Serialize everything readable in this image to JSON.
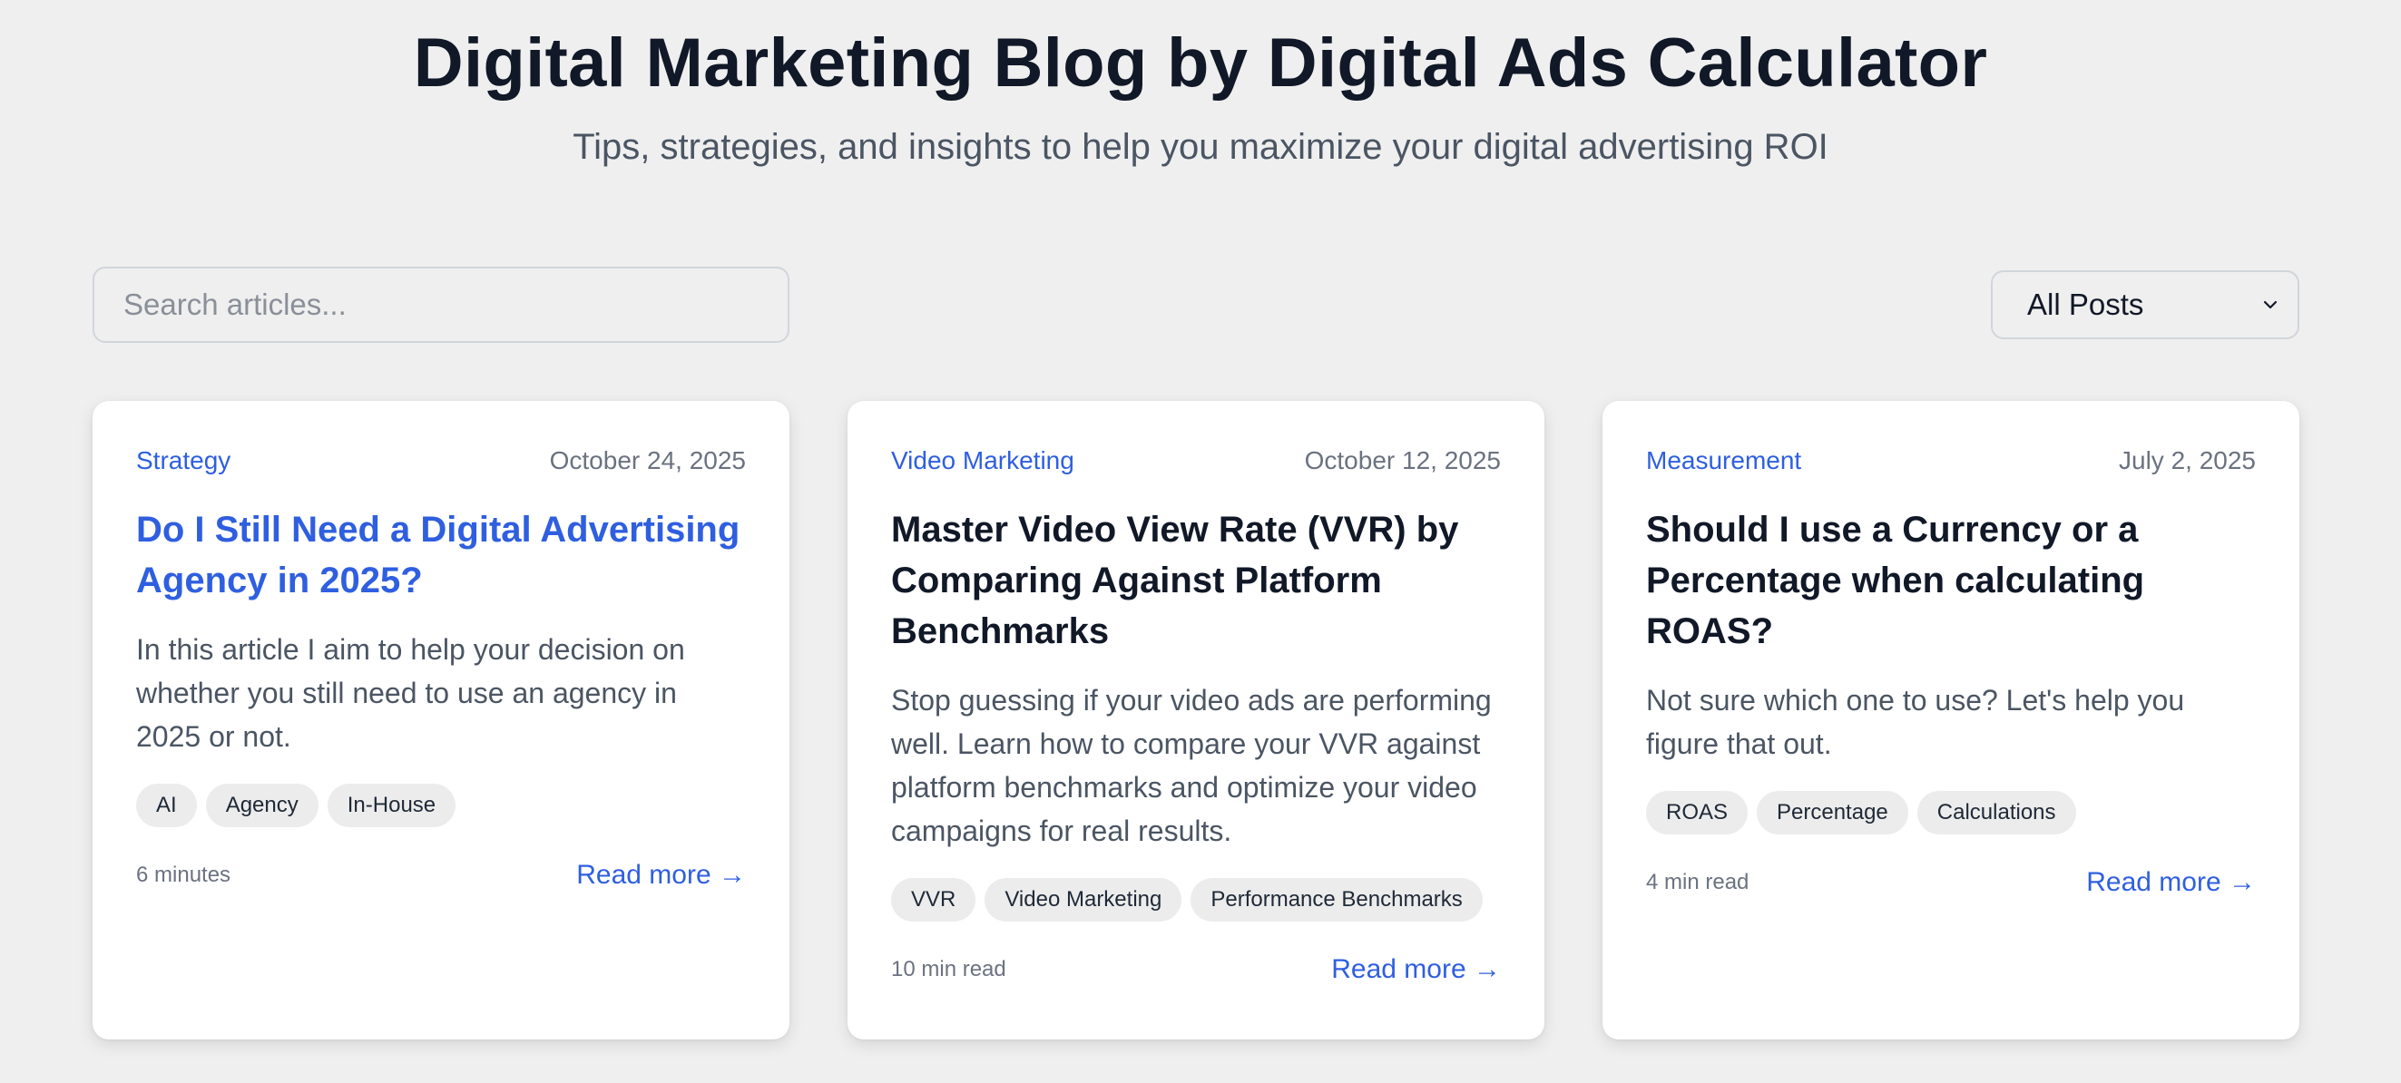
{
  "header": {
    "title": "Digital Marketing Blog by Digital Ads Calculator",
    "subtitle": "Tips, strategies, and insights to help you maximize your digital advertising ROI"
  },
  "controls": {
    "search_placeholder": "Search articles...",
    "filter_selected": "All Posts"
  },
  "cards": [
    {
      "category": "Strategy",
      "date": "October 24, 2025",
      "title": "Do I Still Need a Digital Advertising Agency in 2025?",
      "excerpt": "In this article I aim to help your decision on whether you still need to use an agency in 2025 or not.",
      "tags": [
        "AI",
        "Agency",
        "In-House"
      ],
      "read_time": "6 minutes",
      "read_more": "Read more →"
    },
    {
      "category": "Video Marketing",
      "date": "October 12, 2025",
      "title": "Master Video View Rate (VVR) by Comparing Against Platform Benchmarks",
      "excerpt": "Stop guessing if your video ads are performing well. Learn how to compare your VVR against platform benchmarks and optimize your video campaigns for real results.",
      "tags": [
        "VVR",
        "Video Marketing",
        "Performance Benchmarks"
      ],
      "read_time": "10 min read",
      "read_more": "Read more →"
    },
    {
      "category": "Measurement",
      "date": "July 2, 2025",
      "title": "Should I use a Currency or a Percentage when calculating ROAS?",
      "excerpt": "Not sure which one to use? Let's help you figure that out.",
      "tags": [
        "ROAS",
        "Percentage",
        "Calculations"
      ],
      "read_time": "4 min read",
      "read_more": "Read more →"
    }
  ],
  "icons": {
    "filter_chevron": "chevron-down-icon"
  },
  "colors": {
    "accent": "#2f5fe0",
    "background": "#efefef",
    "title": "#111827",
    "muted": "#6b7280"
  }
}
